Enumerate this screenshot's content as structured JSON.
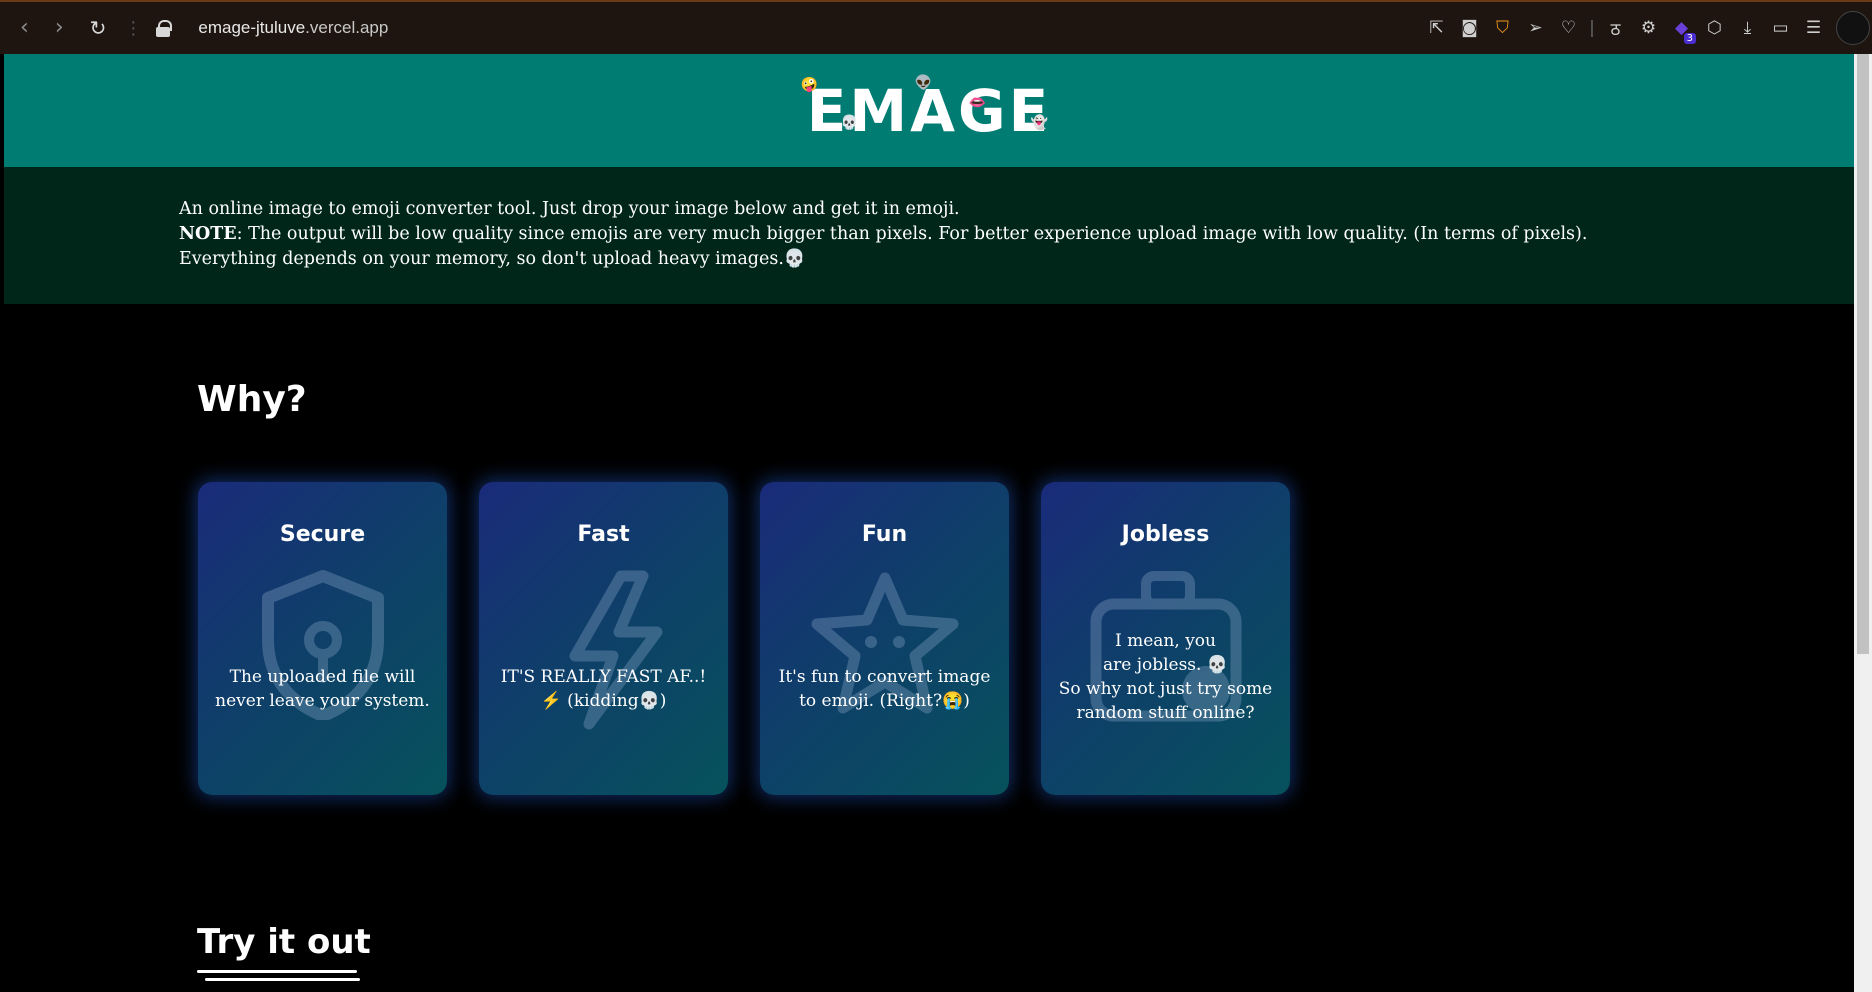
{
  "browser": {
    "url_domain": "emage-jtuluve",
    "url_rest": ".vercel.app",
    "extensions_badge": "3"
  },
  "header": {
    "logo_text": "EMAGE"
  },
  "intro": {
    "line1": "An online image to emoji converter tool. Just drop your image below and get it in emoji.",
    "note_label": "NOTE",
    "note_text": ": The output will be low quality since emojis are very much bigger than pixels. For better experience upload image with low quality. (In terms of pixels). Everything depends on your memory, so don't upload heavy images.💀"
  },
  "why": {
    "heading": "Why?",
    "cards": [
      {
        "title": "Secure",
        "text": "The uploaded file will never leave your system.",
        "icon": "shield-icon"
      },
      {
        "title": "Fast",
        "text": "IT'S REALLY FAST AF..! ⚡ (kidding💀)",
        "icon": "bolt-icon"
      },
      {
        "title": "Fun",
        "text": "It's fun to convert image to emoji. (Right?😭)",
        "icon": "star-icon"
      },
      {
        "title": "Jobless",
        "text_line1": "I mean, you",
        "text_line2": "are jobless. 💀",
        "text_line3": "So why not just try some random stuff online?",
        "icon": "briefcase-icon"
      }
    ]
  },
  "try": {
    "heading": "Try it out"
  },
  "colors": {
    "banner": "#007c73",
    "intro_bg": "#00261a",
    "page_bg": "#000000"
  }
}
